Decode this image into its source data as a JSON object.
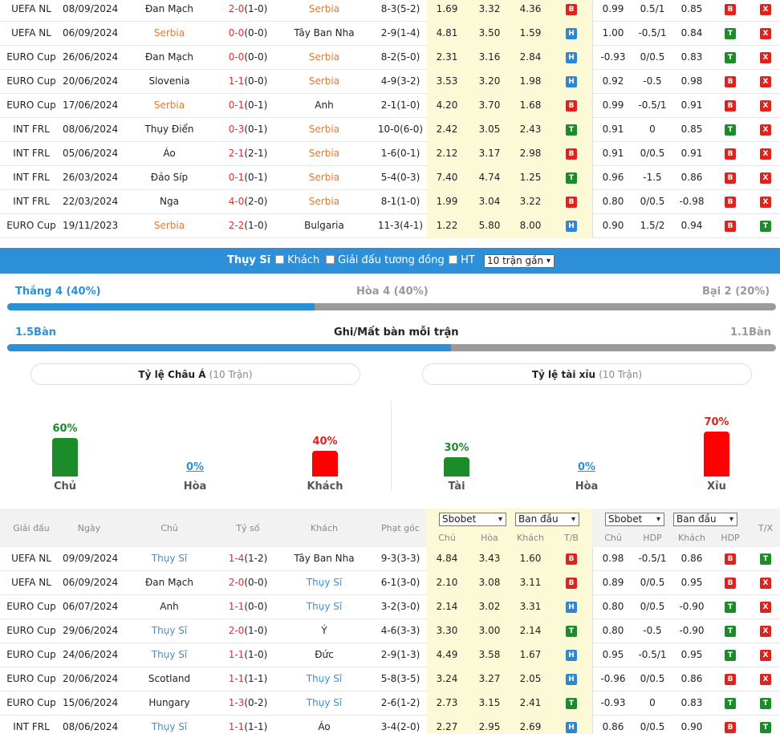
{
  "top_rows": [
    {
      "league": "UEFA NL",
      "date": "08/09/2024",
      "home": "Đan Mạch",
      "home_hl": false,
      "score": "2-0",
      "ht": "(1-0)",
      "away": "Serbia",
      "away_hl": true,
      "corner": "8-3(5-2)",
      "o1": "1.69",
      "o2": "3.32",
      "o3": "4.36",
      "tb": "B",
      "h1": "0.99",
      "h2": "0.5/1",
      "h3": "0.85",
      "hdp": "B",
      "tx": "X"
    },
    {
      "league": "UEFA NL",
      "date": "06/09/2024",
      "home": "Serbia",
      "home_hl": true,
      "score": "0-0",
      "ht": "(0-0)",
      "away": "Tây Ban Nha",
      "away_hl": false,
      "corner": "2-9(1-4)",
      "o1": "4.81",
      "o2": "3.50",
      "o3": "1.59",
      "tb": "H",
      "h1": "1.00",
      "h2": "-0.5/1",
      "h3": "0.84",
      "hdp": "T",
      "tx": "X"
    },
    {
      "league": "EURO Cup",
      "date": "26/06/2024",
      "home": "Đan Mạch",
      "home_hl": false,
      "score": "0-0",
      "ht": "(0-0)",
      "away": "Serbia",
      "away_hl": true,
      "corner": "8-2(5-0)",
      "o1": "2.31",
      "o2": "3.16",
      "o3": "2.84",
      "tb": "H",
      "h1": "-0.93",
      "h2": "0/0.5",
      "h3": "0.83",
      "hdp": "T",
      "tx": "X"
    },
    {
      "league": "EURO Cup",
      "date": "20/06/2024",
      "home": "Slovenia",
      "home_hl": false,
      "score": "1-1",
      "ht": "(0-0)",
      "away": "Serbia",
      "away_hl": true,
      "corner": "4-9(3-2)",
      "o1": "3.53",
      "o2": "3.20",
      "o3": "1.98",
      "tb": "H",
      "h1": "0.92",
      "h2": "-0.5",
      "h3": "0.98",
      "hdp": "B",
      "tx": "X"
    },
    {
      "league": "EURO Cup",
      "date": "17/06/2024",
      "home": "Serbia",
      "home_hl": true,
      "score": "0-1",
      "ht": "(0-1)",
      "away": "Anh",
      "away_hl": false,
      "corner": "2-1(1-0)",
      "o1": "4.20",
      "o2": "3.70",
      "o3": "1.68",
      "tb": "B",
      "h1": "0.99",
      "h2": "-0.5/1",
      "h3": "0.91",
      "hdp": "B",
      "tx": "X"
    },
    {
      "league": "INT FRL",
      "date": "08/06/2024",
      "home": "Thụy Điển",
      "home_hl": false,
      "score": "0-3",
      "ht": "(0-1)",
      "away": "Serbia",
      "away_hl": true,
      "corner": "10-0(6-0)",
      "o1": "2.42",
      "o2": "3.05",
      "o3": "2.43",
      "tb": "T",
      "h1": "0.91",
      "h2": "0",
      "h3": "0.85",
      "hdp": "T",
      "tx": "X"
    },
    {
      "league": "INT FRL",
      "date": "05/06/2024",
      "home": "Áo",
      "home_hl": false,
      "score": "2-1",
      "ht": "(2-1)",
      "away": "Serbia",
      "away_hl": true,
      "corner": "1-6(0-1)",
      "o1": "2.12",
      "o2": "3.17",
      "o3": "2.98",
      "tb": "B",
      "h1": "0.91",
      "h2": "0/0.5",
      "h3": "0.91",
      "hdp": "B",
      "tx": "X"
    },
    {
      "league": "INT FRL",
      "date": "26/03/2024",
      "home": "Đảo Síp",
      "home_hl": false,
      "score": "0-1",
      "ht": "(0-1)",
      "away": "Serbia",
      "away_hl": true,
      "corner": "5-4(0-3)",
      "o1": "7.40",
      "o2": "4.74",
      "o3": "1.25",
      "tb": "T",
      "h1": "0.96",
      "h2": "-1.5",
      "h3": "0.86",
      "hdp": "B",
      "tx": "X"
    },
    {
      "league": "INT FRL",
      "date": "22/03/2024",
      "home": "Nga",
      "home_hl": false,
      "score": "4-0",
      "ht": "(2-0)",
      "away": "Serbia",
      "away_hl": true,
      "corner": "8-1(1-0)",
      "o1": "1.99",
      "o2": "3.04",
      "o3": "3.22",
      "tb": "B",
      "h1": "0.80",
      "h2": "0/0.5",
      "h3": "-0.98",
      "hdp": "B",
      "tx": "X"
    },
    {
      "league": "EURO Cup",
      "date": "19/11/2023",
      "home": "Serbia",
      "home_hl": true,
      "score": "2-2",
      "ht": "(1-0)",
      "away": "Bulgaria",
      "away_hl": false,
      "corner": "11-3(4-1)",
      "o1": "1.22",
      "o2": "5.80",
      "o3": "8.00",
      "tb": "H",
      "h1": "0.90",
      "h2": "1.5/2",
      "h3": "0.94",
      "hdp": "B",
      "tx": "T"
    }
  ],
  "filter": {
    "team": "Thụy Sĩ",
    "opt_away": "Khách",
    "opt_same": "Giải đấu tương đồng",
    "opt_ht": "HT",
    "select_value": "10 trận gần"
  },
  "record": {
    "win": "Thắng 4 (40%)",
    "draw": "Hòa 4 (40%)",
    "loss": "Bại 2 (20%)",
    "win_fraction": 0.4
  },
  "goals": {
    "left": "1.5Bàn",
    "title": "Ghi/Mất bàn mỗi trận",
    "right": "1.1Bàn",
    "fraction": 0.577
  },
  "asian": {
    "title": "Tỷ lệ Châu Á",
    "count": "(10 Trận)",
    "bars": [
      {
        "pct": "60%",
        "label": "Chủ",
        "value": 0.6,
        "color": "#1c8c2a"
      },
      {
        "pct": "0%",
        "label": "Hòa",
        "value": 0,
        "color": "#2c8fd8"
      },
      {
        "pct": "40%",
        "label": "Khách",
        "value": 0.4,
        "color": "#ff0000"
      }
    ]
  },
  "ou": {
    "title": "Tỷ lệ tài xỉu",
    "count": "(10 Trận)",
    "bars": [
      {
        "pct": "30%",
        "label": "Tài",
        "value": 0.3,
        "color": "#1c8c2a"
      },
      {
        "pct": "0%",
        "label": "Hòa",
        "value": 0,
        "color": "#2c8fd8"
      },
      {
        "pct": "70%",
        "label": "Xỉu",
        "value": 0.7,
        "color": "#ff0000"
      }
    ]
  },
  "table_header": {
    "league": "Giải đấu",
    "date": "Ngày",
    "home": "Chủ",
    "score": "Tỷ số",
    "away": "Khách",
    "corner": "Phạt góc",
    "book1": "Sbobet",
    "type1": "Ban đầu",
    "book2": "Sbobet",
    "type2": "Ban đầu",
    "sub": [
      "Chủ",
      "Hòa",
      "Khách",
      "T/B",
      "Chủ",
      "HDP",
      "Khách",
      "HDP"
    ],
    "tx": "T/X"
  },
  "bottom_rows": [
    {
      "league": "UEFA NL",
      "date": "09/09/2024",
      "home": "Thụy Sĩ",
      "home_hl": true,
      "score": "1-4",
      "ht": "(1-2)",
      "away": "Tây Ban Nha",
      "away_hl": false,
      "corner": "9-3(3-3)",
      "o1": "4.84",
      "o2": "3.43",
      "o3": "1.60",
      "tb": "B",
      "h1": "0.98",
      "h2": "-0.5/1",
      "h3": "0.86",
      "hdp": "B",
      "tx": "T"
    },
    {
      "league": "UEFA NL",
      "date": "06/09/2024",
      "home": "Đan Mạch",
      "home_hl": false,
      "score": "2-0",
      "ht": "(0-0)",
      "away": "Thụy Sĩ",
      "away_hl": true,
      "corner": "6-1(3-0)",
      "o1": "2.10",
      "o2": "3.08",
      "o3": "3.11",
      "tb": "B",
      "h1": "0.89",
      "h2": "0/0.5",
      "h3": "0.95",
      "hdp": "B",
      "tx": "X"
    },
    {
      "league": "EURO Cup",
      "date": "06/07/2024",
      "home": "Anh",
      "home_hl": false,
      "score": "1-1",
      "ht": "(0-0)",
      "away": "Thụy Sĩ",
      "away_hl": true,
      "corner": "3-2(3-0)",
      "o1": "2.14",
      "o2": "3.02",
      "o3": "3.31",
      "tb": "H",
      "h1": "0.80",
      "h2": "0/0.5",
      "h3": "-0.90",
      "hdp": "T",
      "tx": "X"
    },
    {
      "league": "EURO Cup",
      "date": "29/06/2024",
      "home": "Thụy Sĩ",
      "home_hl": true,
      "score": "2-0",
      "ht": "(1-0)",
      "away": "Ý",
      "away_hl": false,
      "corner": "4-6(3-3)",
      "o1": "3.30",
      "o2": "3.00",
      "o3": "2.14",
      "tb": "T",
      "h1": "0.80",
      "h2": "-0.5",
      "h3": "-0.90",
      "hdp": "T",
      "tx": "X"
    },
    {
      "league": "EURO Cup",
      "date": "24/06/2024",
      "home": "Thụy Sĩ",
      "home_hl": true,
      "score": "1-1",
      "ht": "(1-0)",
      "away": "Đức",
      "away_hl": false,
      "corner": "2-9(1-3)",
      "o1": "4.49",
      "o2": "3.58",
      "o3": "1.67",
      "tb": "H",
      "h1": "0.95",
      "h2": "-0.5/1",
      "h3": "0.95",
      "hdp": "T",
      "tx": "X"
    },
    {
      "league": "EURO Cup",
      "date": "20/06/2024",
      "home": "Scotland",
      "home_hl": false,
      "score": "1-1",
      "ht": "(1-1)",
      "away": "Thụy Sĩ",
      "away_hl": true,
      "corner": "5-8(3-5)",
      "o1": "3.24",
      "o2": "3.27",
      "o3": "2.05",
      "tb": "H",
      "h1": "-0.96",
      "h2": "0/0.5",
      "h3": "0.86",
      "hdp": "B",
      "tx": "X"
    },
    {
      "league": "EURO Cup",
      "date": "15/06/2024",
      "home": "Hungary",
      "home_hl": false,
      "score": "1-3",
      "ht": "(0-2)",
      "away": "Thụy Sĩ",
      "away_hl": true,
      "corner": "2-6(1-2)",
      "o1": "2.73",
      "o2": "3.15",
      "o3": "2.41",
      "tb": "T",
      "h1": "-0.93",
      "h2": "0",
      "h3": "0.83",
      "hdp": "T",
      "tx": "T"
    },
    {
      "league": "INT FRL",
      "date": "08/06/2024",
      "home": "Thụy Sĩ",
      "home_hl": true,
      "score": "1-1",
      "ht": "(1-1)",
      "away": "Áo",
      "away_hl": false,
      "corner": "3-4(2-0)",
      "o1": "2.27",
      "o2": "2.95",
      "o3": "2.69",
      "tb": "H",
      "h1": "0.86",
      "h2": "0/0.5",
      "h3": "0.90",
      "hdp": "B",
      "tx": "T"
    }
  ],
  "colors": {
    "accent": "#2c8fd8",
    "win": "#1c8c2a",
    "loss": "#e0221c",
    "draw_badge": "#2f86d4",
    "highlight_serbia": "#e07b39",
    "highlight_swiss": "#3d8fd0",
    "odds_bg": "#fbf9d6"
  },
  "icons": {
    "checkbox": "checkbox-icon",
    "select": "chevron-down-icon"
  }
}
